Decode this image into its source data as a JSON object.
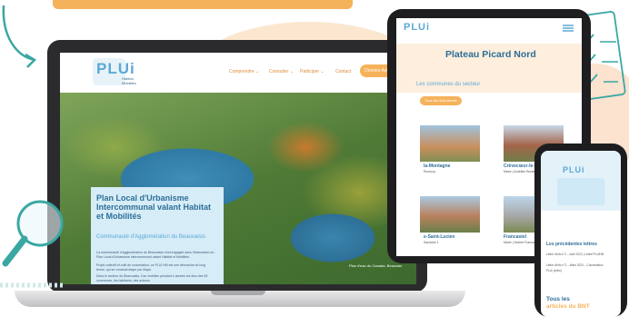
{
  "laptop": {
    "logo": "PLUi",
    "logo_sub": "Habitat\nMobilités",
    "nav": [
      "Comprendre ⌄",
      "Consulter ⌄",
      "Participer ⌄",
      "Contact"
    ],
    "cta": "Donnez Avis",
    "title": "Plan Local d'Urbanisme Intercommunal valant Habitat et Mobilités",
    "subtitle": "Communauté d'Agglomération du Beauvaisis",
    "body1": "La communauté d'agglomération du Beauvaisis s'est engagée dans l'élaboration du Plan Local d'Urbanisme intercommunal valant Habitat et Mobilités.",
    "body2": "Projet collectif et outil de concertation, ce PLUi HM est une démarche de long terme, qui se construit étape par étape.",
    "body3": "Dans le secteur du Beauvaisis, il se mobilise pendant 4 années les élus des 53 communes, les habitants, des acteurs",
    "photo_credit": "Plan d'eau du Canada, Beauvais"
  },
  "tablet": {
    "logo": "PLUi",
    "title": "Plateau Picard Nord",
    "intro": "Les communes du secteur",
    "button": "Tous les documents",
    "towns": [
      {
        "name": "la-Montagne",
        "line": "Rouvroy"
      },
      {
        "name": "Crèvecœur-le-Gra",
        "line": "Maire | Aurélien Boutetz"
      },
      {
        "name": "e-Saint-Lucien",
        "line": "Sanitaire 1"
      },
      {
        "name": "Francastel",
        "line": "Maire | Hubert Francaisel"
      }
    ]
  },
  "phone": {
    "logo": "PLUi",
    "heading": "Les précédentes lettres",
    "item1": "Lettre d'info n°1 – Avril 2022 | Lettre PLUiHM",
    "item2": "Lettre d'info n°2 – Mars 2023 – Concertation",
    "item3": "PLUi (enfin)",
    "bottom1": "Tous les",
    "bottom2": "articles du BNT"
  },
  "colors": {
    "accent": "#f6b25b",
    "blue": "#5aa9d6",
    "dark_blue": "#2d6f97",
    "teal": "#3aa7a3"
  },
  "icons": [
    "arrow-icon",
    "magnifier-icon",
    "clipboard-icon",
    "checkbox-icon"
  ]
}
